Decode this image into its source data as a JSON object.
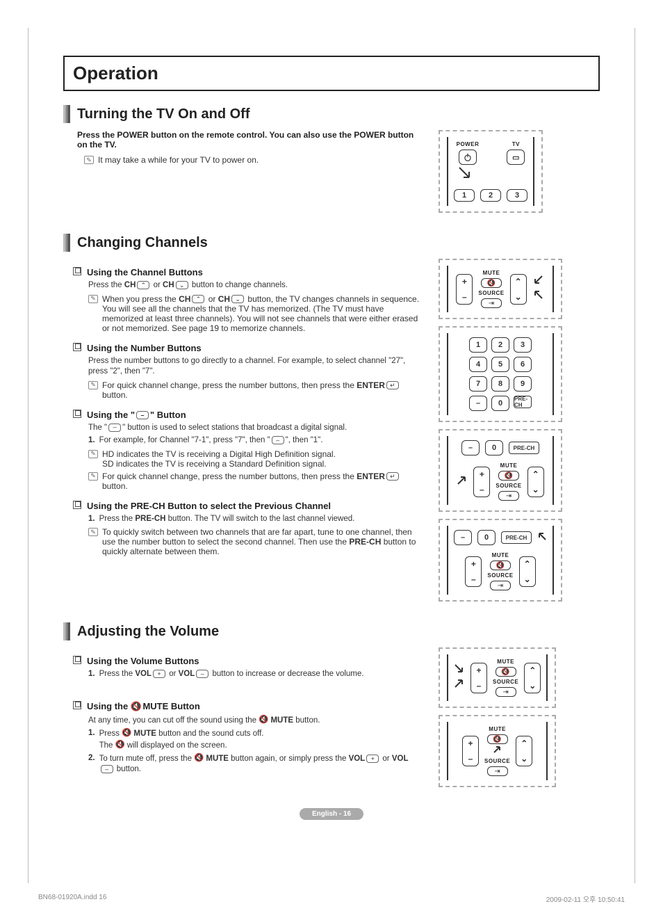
{
  "page": {
    "title": "Operation",
    "badge": "English - 16"
  },
  "footer": {
    "left": "BN68-01920A.indd   16",
    "right": "2009-02-11   오후 10:50:41"
  },
  "s1": {
    "heading": "Turning the TV On and Off",
    "intro": "Press the POWER button on the remote control. You can also use the POWER button on the TV.",
    "note": "It may take a while for your TV to power on.",
    "fig": {
      "power": "POWER",
      "tv": "TV",
      "b1": "1",
      "b2": "2",
      "b3": "3"
    }
  },
  "s2": {
    "heading": "Changing Channels",
    "sub1": {
      "title": "Using the Channel Buttons",
      "line1a": "Press the ",
      "line1b": "CH",
      "line1c": " or ",
      "line1d": "CH",
      "line1e": " button to change channels.",
      "note_a": "When you press the ",
      "note_b": "CH",
      "note_c": " or ",
      "note_d": "CH",
      "note_e": " button, the TV changes channels in sequence. You will see all the channels that the TV has memorized. (The TV must have memorized at least three channels). You will not see channels that were either erased or not memorized. See page 19 to memorize channels."
    },
    "sub2": {
      "title": "Using the Number Buttons",
      "line": "Press the number buttons to go directly to a channel. For example, to select channel \"27\", press \"2\", then \"7\".",
      "note_a": "For quick channel change, press the number buttons, then press the ",
      "note_b": "ENTER",
      "note_c": " button."
    },
    "sub3": {
      "title_a": "Using the \"",
      "title_b": "\" Button",
      "line_a": "The \"",
      "line_b": "\" button is used to select stations that broadcast a digital signal.",
      "step1_a": "For example, for Channel \"7-1\", press \"7\", then \"",
      "step1_b": "\", then \"1\".",
      "note1": "HD indicates the TV is receiving a Digital High Definition signal.\nSD indicates the TV is receiving a Standard Definition signal.",
      "note2_a": "For quick channel change, press the number buttons, then press the ",
      "note2_b": "ENTER",
      "note2_c": " button."
    },
    "sub4": {
      "title": "Using the PRE-CH Button to select the Previous Channel",
      "step1_a": "Press the ",
      "step1_b": "PRE-CH",
      "step1_c": " button. The TV will switch to the last channel viewed.",
      "note_a": "To quickly switch between two channels that are far apart, tune to one channel, then use the number button to select the second channel. Then use the ",
      "note_b": "PRE-CH",
      "note_c": " button to quickly alternate between them."
    },
    "fig": {
      "mute": "MUTE",
      "source": "SOURCE",
      "prech": "PRE-CH",
      "n0": "0",
      "n1": "1",
      "n2": "2",
      "n3": "3",
      "n4": "4",
      "n5": "5",
      "n6": "6",
      "n7": "7",
      "n8": "8",
      "n9": "9",
      "dash": "–"
    }
  },
  "s3": {
    "heading": "Adjusting the Volume",
    "sub1": {
      "title": "Using the Volume Buttons",
      "step1_a": "Press the ",
      "step1_b": "VOL",
      "step1_c": " or ",
      "step1_d": "VOL",
      "step1_e": " button to increase or decrease the volume."
    },
    "sub2": {
      "title_a": "Using the ",
      "title_b": " MUTE Button",
      "line_a": "At any time, you can cut off the sound using the ",
      "line_b": " MUTE",
      "line_c": " button.",
      "step1_a": "Press ",
      "step1_b": " MUTE",
      "step1_c": " button and the sound cuts off.\nThe ",
      "step1_d": " will displayed on the screen.",
      "step2_a": "To turn mute off, press the ",
      "step2_b": " MUTE",
      "step2_c": " button again, or simply press the ",
      "step2_d": "VOL",
      "step2_e": " or ",
      "step2_f": "VOL",
      "step2_g": " button."
    },
    "fig": {
      "mute": "MUTE",
      "source": "SOURCE"
    }
  }
}
